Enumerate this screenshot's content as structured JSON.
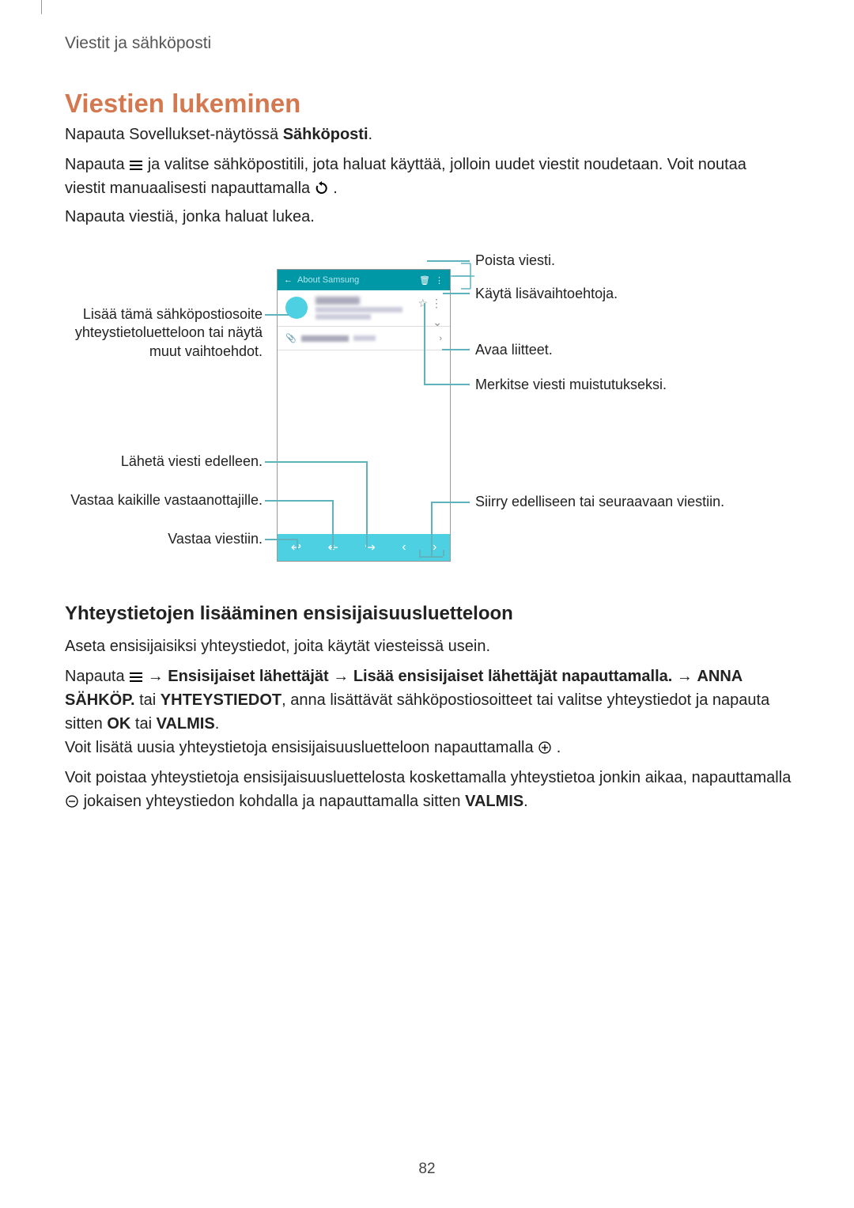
{
  "header": {
    "breadcrumb": "Viestit ja sähköposti"
  },
  "section": {
    "title": "Viestien lukeminen"
  },
  "paragraphs": {
    "p1_prefix": "Napauta Sovellukset-näytössä ",
    "p1_bold": "Sähköposti",
    "p1_suffix": ".",
    "p2_prefix": "Napauta ",
    "p2_mid": " ja valitse sähköpostitili, jota haluat käyttää, jolloin uudet viestit noudetaan. Voit noutaa viestit manuaalisesti napauttamalla ",
    "p2_suffix": ".",
    "p3": "Napauta viestiä, jonka haluat lukea."
  },
  "annotations": {
    "delete": "Poista viesti.",
    "options": "Käytä lisävaihtoehtoja.",
    "add_contact": "Lisää tämä sähköpostiosoite yhteystietoluetteloon tai näytä muut vaihtoehdot.",
    "attachments": "Avaa liitteet.",
    "reminder": "Merkitse viesti muistutukseksi.",
    "forward": "Lähetä viesti edelleen.",
    "reply_all": "Vastaa kaikille vastaanottajille.",
    "reply": "Vastaa viestiin.",
    "prev_next": "Siirry edelliseen tai seuraavaan viestiin."
  },
  "phone": {
    "title": "About Samsung"
  },
  "subsection": {
    "title": "Yhteystietojen lisääminen ensisijaisuusluetteloon"
  },
  "paragraphs2": {
    "p4": "Aseta ensisijaisiksi yhteystiedot, joita käytät viesteissä usein.",
    "p5_prefix": "Napauta ",
    "p5_arrow": " → ",
    "p5_b1": "Ensisijaiset lähettäjät",
    "p5_b2": "Lisää ensisijaiset lähettäjät napauttamalla.",
    "p5_b3": "ANNA SÄHKÖP.",
    "p5_mid": " tai ",
    "p5_b4": "YHTEYSTIEDOT",
    "p5_mid2": ", anna lisättävät sähköpostiosoitteet tai valitse yhteystiedot ja napauta sitten ",
    "p5_b5": "OK",
    "p5_b6": "VALMIS",
    "p5_suffix": ".",
    "p6_prefix": "Voit lisätä uusia yhteystietoja ensisijaisuusluetteloon napauttamalla ",
    "p6_suffix": ".",
    "p7_prefix": "Voit poistaa yhteystietoja ensisijaisuusluettelosta koskettamalla yhteystietoa jonkin aikaa, napauttamalla ",
    "p7_mid": " jokaisen yhteystiedon kohdalla ja napauttamalla sitten ",
    "p7_bold": "VALMIS",
    "p7_suffix": "."
  },
  "page_number": "82"
}
